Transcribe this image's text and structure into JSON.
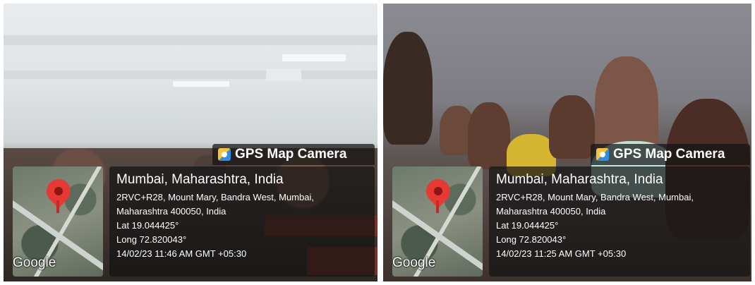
{
  "left": {
    "badge": "GPS Map Camera",
    "map_brand": "Google",
    "location": "Mumbai, Maharashtra, India",
    "address_line1": "2RVC+R28, Mount Mary, Bandra West, Mumbai,",
    "address_line2": "Maharashtra 400050, India",
    "lat": "Lat 19.044425°",
    "long": "Long 72.820043°",
    "timestamp": "14/02/23 11:46 AM GMT +05:30"
  },
  "right": {
    "badge": "GPS Map Camera",
    "map_brand": "Google",
    "location": "Mumbai, Maharashtra, India",
    "address_line1": "2RVC+R28, Mount Mary, Bandra West, Mumbai,",
    "address_line2": "Maharashtra 400050, India",
    "lat": "Lat 19.044425°",
    "long": "Long 72.820043°",
    "timestamp": "14/02/23 11:25 AM GMT +05:30"
  },
  "colors": {
    "overlay": "#141414",
    "pin": "#e53935",
    "desk": "#7a2f27"
  },
  "icons": [
    "gps-map-camera-app-icon",
    "location-pin-icon"
  ]
}
